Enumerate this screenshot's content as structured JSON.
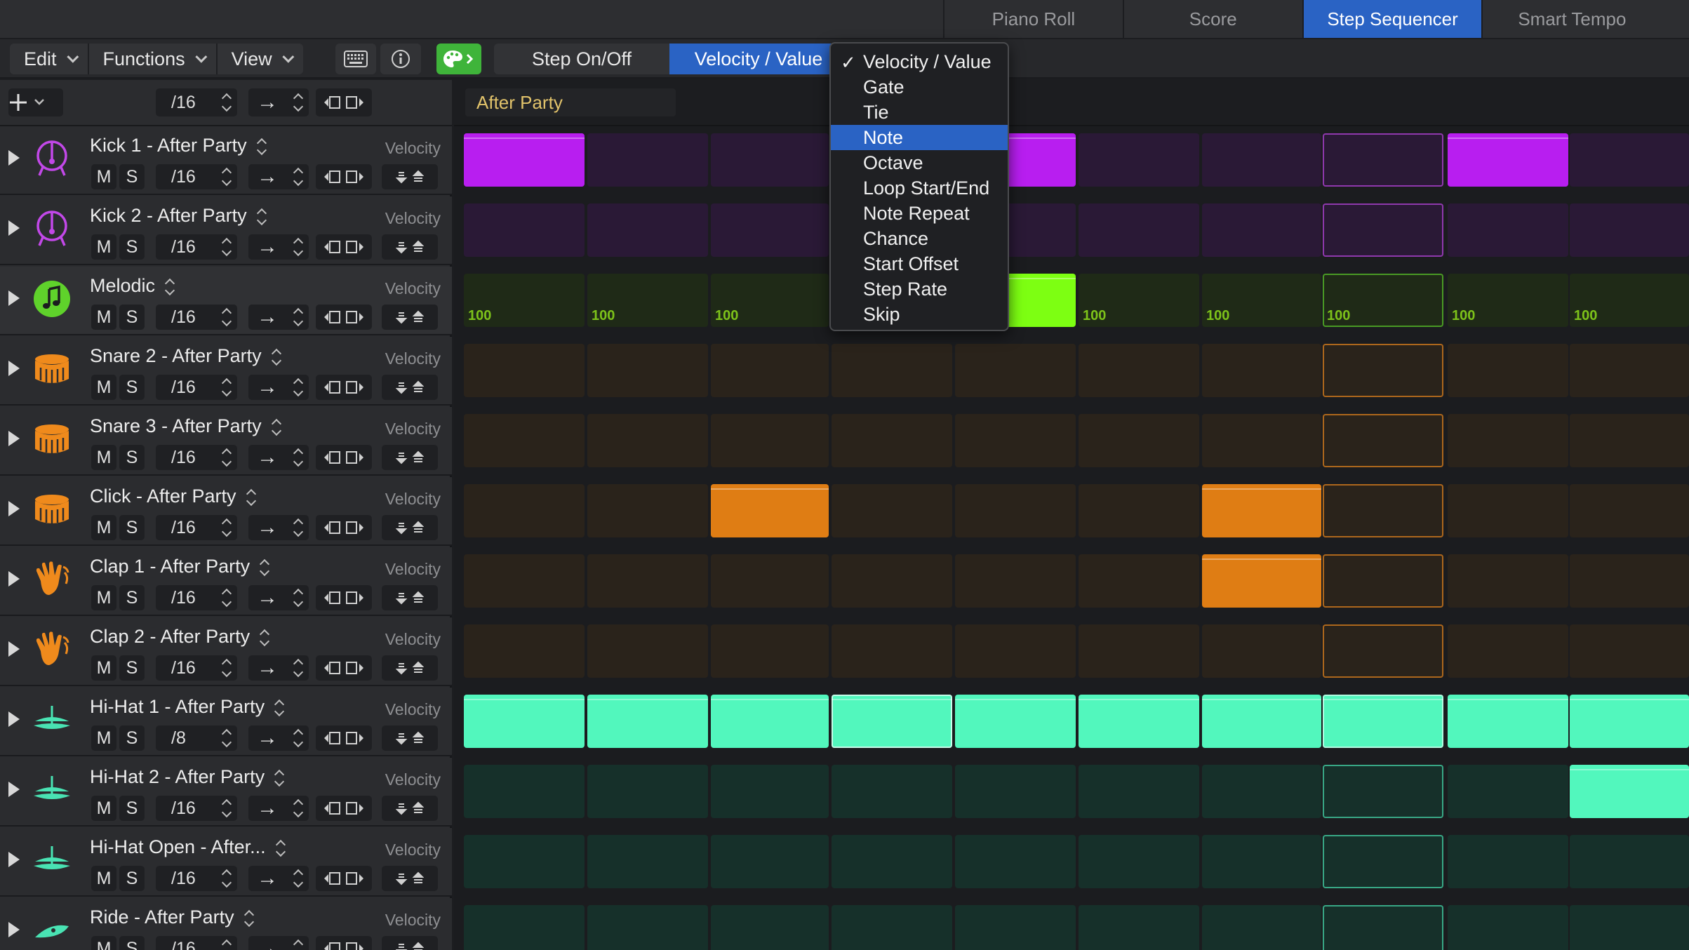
{
  "tabs": [
    {
      "label": "Piano Roll",
      "active": false
    },
    {
      "label": "Score",
      "active": false
    },
    {
      "label": "Step Sequencer",
      "active": true
    },
    {
      "label": "Smart Tempo",
      "active": false
    }
  ],
  "toolbar": {
    "menus": [
      "Edit",
      "Functions",
      "View"
    ],
    "keyboard_icon": "keyboard-icon",
    "info_icon": "info-icon",
    "pattern_icon": "palette-icon",
    "segment": [
      {
        "label": "Step On/Off",
        "active": false
      },
      {
        "label": "Velocity / Value",
        "active": true
      }
    ]
  },
  "header_controls": {
    "add_icon": "plus-icon",
    "rate": "/16",
    "direction": "→",
    "move_icons": "shift-left-right-icon"
  },
  "pattern": {
    "name": "After Party"
  },
  "dropdown": {
    "items": [
      {
        "label": "Velocity / Value",
        "checked": true,
        "highlighted": false
      },
      {
        "label": "Gate",
        "checked": false,
        "highlighted": false
      },
      {
        "label": "Tie",
        "checked": false,
        "highlighted": false
      },
      {
        "label": "Note",
        "checked": false,
        "highlighted": true
      },
      {
        "label": "Octave",
        "checked": false,
        "highlighted": false
      },
      {
        "label": "Loop Start/End",
        "checked": false,
        "highlighted": false
      },
      {
        "label": "Note Repeat",
        "checked": false,
        "highlighted": false
      },
      {
        "label": "Chance",
        "checked": false,
        "highlighted": false
      },
      {
        "label": "Start Offset",
        "checked": false,
        "highlighted": false
      },
      {
        "label": "Step Rate",
        "checked": false,
        "highlighted": false
      },
      {
        "label": "Skip",
        "checked": false,
        "highlighted": false
      }
    ]
  },
  "colors": {
    "purple_on": "#b81ef0",
    "purple_off": "#2a1936",
    "purple_icon": "#c248e8",
    "green_on": "#7dff12",
    "green_off": "#1f2a17",
    "green_icon": "#5fd22b",
    "orange_on": "#df7d14",
    "orange_off": "#2a231b",
    "orange_icon": "#ef8a1c",
    "teal_on": "#52f7bd",
    "teal_off": "#16302a",
    "teal_icon": "#49e3b3",
    "accent": "#2a63c4"
  },
  "track_controls": {
    "mute": "M",
    "solo": "S",
    "direction": "→"
  },
  "tracks": [
    {
      "name": "Kick 1 - After Party",
      "param": "Velocity",
      "rate": "/16",
      "color": "purple",
      "icon": "kick-drum-icon",
      "steps": [
        1,
        0,
        0,
        0,
        1,
        0,
        0,
        0,
        1,
        0
      ],
      "values": null
    },
    {
      "name": "Kick 2 - After Party",
      "param": "Velocity",
      "rate": "/16",
      "color": "purple",
      "icon": "kick-drum-icon",
      "steps": [
        0,
        0,
        0,
        0,
        0,
        0,
        0,
        0,
        0,
        0
      ],
      "values": null
    },
    {
      "name": "Melodic",
      "param": "Velocity",
      "rate": "/16",
      "color": "green",
      "icon": "music-note-icon",
      "steps": [
        0,
        0,
        0,
        0,
        1,
        0,
        0,
        0,
        0,
        0
      ],
      "values": [
        "100",
        "100",
        "100",
        "100",
        "100",
        "100",
        "100",
        "100",
        "100",
        "100"
      ]
    },
    {
      "name": "Snare 2 - After Party",
      "param": "Velocity",
      "rate": "/16",
      "color": "orange",
      "icon": "snare-drum-icon",
      "steps": [
        0,
        0,
        0,
        0,
        0,
        0,
        0,
        0,
        0,
        0
      ],
      "values": null
    },
    {
      "name": "Snare 3 - After Party",
      "param": "Velocity",
      "rate": "/16",
      "color": "orange",
      "icon": "snare-drum-icon",
      "steps": [
        0,
        0,
        0,
        0,
        0,
        0,
        0,
        0,
        0,
        0
      ],
      "values": null
    },
    {
      "name": "Click - After Party",
      "param": "Velocity",
      "rate": "/16",
      "color": "orange",
      "icon": "snare-drum-icon",
      "steps": [
        0,
        0,
        1,
        0,
        0,
        0,
        1,
        0,
        0,
        0
      ],
      "values": null
    },
    {
      "name": "Clap 1 - After Party",
      "param": "Velocity",
      "rate": "/16",
      "color": "orange",
      "icon": "clap-hand-icon",
      "steps": [
        0,
        0,
        0,
        0,
        0,
        0,
        1,
        0,
        0,
        0
      ],
      "values": null
    },
    {
      "name": "Clap 2 - After Party",
      "param": "Velocity",
      "rate": "/16",
      "color": "orange",
      "icon": "clap-hand-icon",
      "steps": [
        0,
        0,
        0,
        0,
        0,
        0,
        0,
        0,
        0,
        0
      ],
      "values": null
    },
    {
      "name": "Hi-Hat 1 - After Party",
      "param": "Velocity",
      "rate": "/8",
      "color": "teal",
      "icon": "hihat-icon",
      "steps": [
        1,
        1,
        1,
        1,
        1,
        1,
        1,
        1,
        1,
        1
      ],
      "values": null
    },
    {
      "name": "Hi-Hat 2 - After Party",
      "param": "Velocity",
      "rate": "/16",
      "color": "teal",
      "icon": "hihat-icon",
      "steps": [
        0,
        0,
        0,
        0,
        0,
        0,
        0,
        0,
        0,
        1
      ],
      "values": null
    },
    {
      "name": "Hi-Hat Open - After...",
      "param": "Velocity",
      "rate": "/16",
      "color": "teal",
      "icon": "hihat-icon",
      "steps": [
        0,
        0,
        0,
        0,
        0,
        0,
        0,
        0,
        0,
        0
      ],
      "values": null
    },
    {
      "name": "Ride - After Party",
      "param": "Velocity",
      "rate": "/16",
      "color": "teal",
      "icon": "ride-cymbal-icon",
      "steps": [
        0,
        0,
        0,
        0,
        0,
        0,
        0,
        0,
        0,
        0
      ],
      "values": null
    }
  ]
}
